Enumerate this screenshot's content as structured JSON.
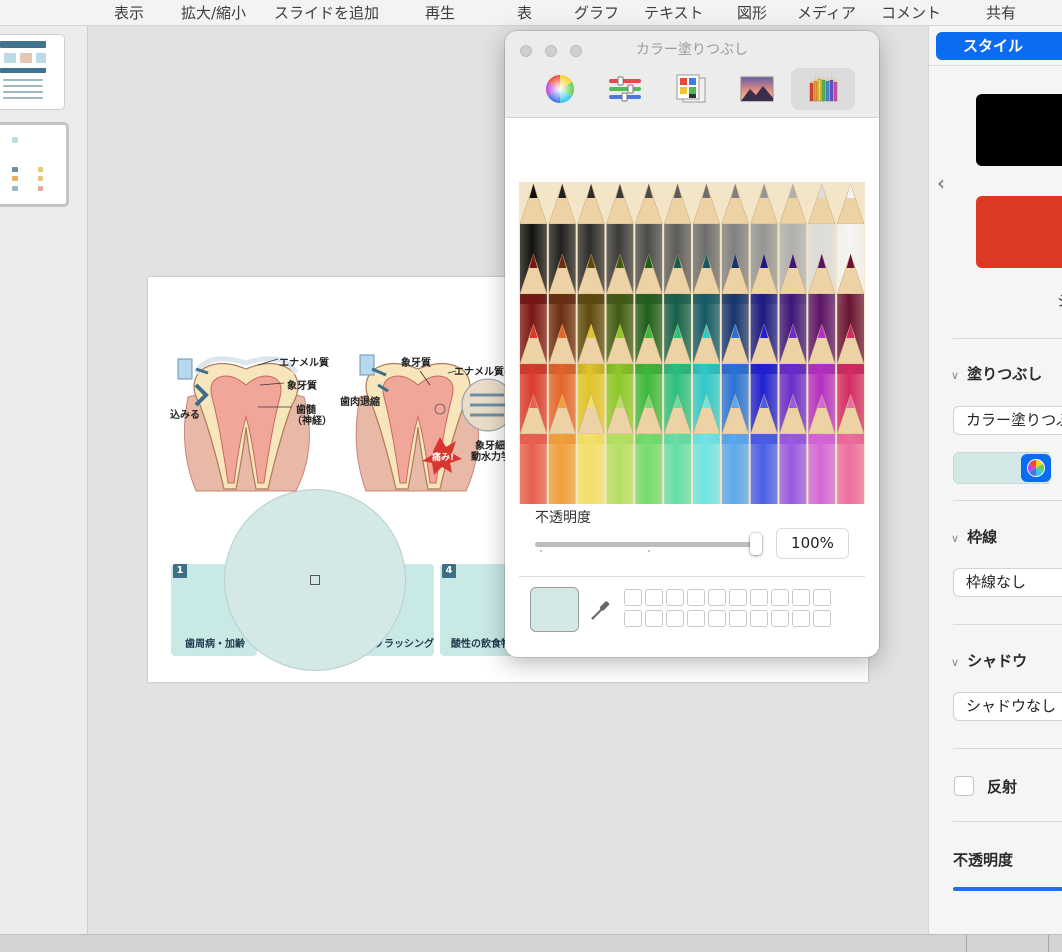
{
  "toolbar": {
    "items": [
      "表示",
      "拡大/縮小",
      "スライドを追加",
      "再生",
      "表",
      "グラフ",
      "テキスト",
      "図形",
      "メディア",
      "コメント",
      "共有"
    ]
  },
  "slide": {
    "top_labels": {
      "enamel_1": "エナメル質",
      "dentin_1": "象牙質",
      "pulp": "歯髄",
      "nerve": "（神経）",
      "pushing": "込みる",
      "dentin_2": "象牙質",
      "enamel_2": "エナメル質の",
      "gum_recession": "歯肉退縮",
      "pain": "痛み!",
      "tubule_1": "象牙細管",
      "tubule_2": "動水力学"
    },
    "cards": [
      {
        "number": "1",
        "label": "歯周病・加齢"
      },
      {
        "number": "",
        "label": "ブラッシング"
      },
      {
        "number": "4",
        "label": "酸性の飲食物"
      }
    ]
  },
  "color_panel": {
    "title": "カラー塗りつぶし",
    "modes": [
      "color-wheel",
      "color-sliders",
      "color-palettes",
      "image-palettes",
      "pencils"
    ],
    "active_mode": "pencils",
    "opacity_label": "不透明度",
    "opacity_value": "100%",
    "opacity_fraction": 1.0,
    "current_color": "#d4e8e6",
    "favorite_slots": 20
  },
  "inspector": {
    "tab": "スタイル",
    "style_presets": [
      "#000000",
      "#dc3a23"
    ],
    "cut_text": "シ",
    "fill": {
      "header": "塗りつぶし",
      "type": "カラー塗りつぶし",
      "color": "#d4e8e6"
    },
    "border": {
      "header": "枠線",
      "type": "枠線なし"
    },
    "shadow": {
      "header": "シャドウ",
      "type": "シャドウなし"
    },
    "reflection_label": "反射",
    "reflection_checked": false,
    "opacity_label": "不透明度"
  },
  "colors": {
    "accent": "#0a6cf0",
    "selection_fill": "#d4e8e6"
  }
}
